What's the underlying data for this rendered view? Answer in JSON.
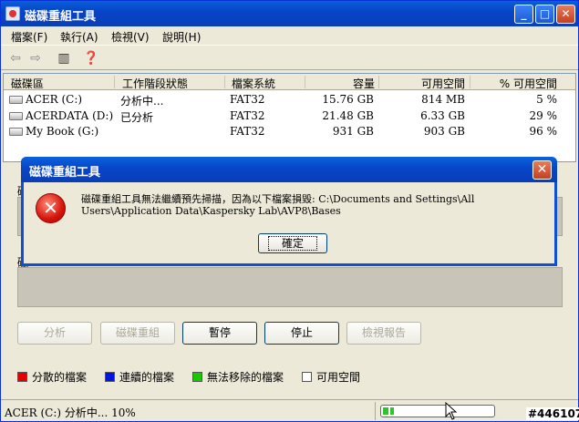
{
  "window": {
    "title": "磁碟重組工具"
  },
  "menu": [
    "檔案(F)",
    "執行(A)",
    "檢視(V)",
    "說明(H)"
  ],
  "list": {
    "columns": [
      "磁碟區",
      "工作階段狀態",
      "檔案系統",
      "容量",
      "可用空間",
      "% 可用空間"
    ],
    "rows": [
      {
        "volume": "ACER (C:)",
        "status": "分析中...",
        "fs": "FAT32",
        "capacity": "15.76 GB",
        "free": "814 MB",
        "pct": "5 %"
      },
      {
        "volume": "ACERDATA (D:)",
        "status": "已分析",
        "fs": "FAT32",
        "capacity": "21.48 GB",
        "free": "6.33 GB",
        "pct": "29 %"
      },
      {
        "volume": "My Book (G:)",
        "status": "",
        "fs": "FAT32",
        "capacity": "931 GB",
        "free": "903 GB",
        "pct": "96 %"
      }
    ]
  },
  "side_labels": [
    "磁",
    "磁"
  ],
  "buttons": [
    "分析",
    "磁碟重組",
    "暫停",
    "停止",
    "檢視報告"
  ],
  "legend": [
    {
      "label": "分散的檔案",
      "color": "#e60000"
    },
    {
      "label": "連續的檔案",
      "color": "#0016e0"
    },
    {
      "label": "無法移除的檔案",
      "color": "#19c800"
    },
    {
      "label": "可用空間",
      "color": "#ffffff"
    }
  ],
  "status": {
    "text": "ACER (C:) 分析中... 10%",
    "progress": 0.1
  },
  "watermark": "#446107",
  "dialog": {
    "title": "磁碟重組工具",
    "message": "磁碟重組工具無法繼續預先掃描，因為以下檔案損毀: C:\\Documents and Settings\\All Users\\Application Data\\Kaspersky Lab\\AVP8\\Bases",
    "ok_label": "確定"
  },
  "colors": {
    "accent": "#0a4fd0",
    "face": "#ece9d8",
    "error": "#d4150a"
  }
}
